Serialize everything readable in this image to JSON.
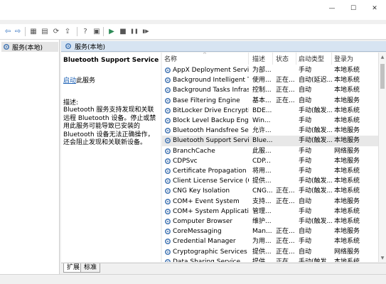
{
  "window": {
    "minimize_glyph": "—",
    "maximize_glyph": "☐",
    "close_glyph": "✕"
  },
  "toolbar": {
    "buttons": [
      {
        "name": "back-icon",
        "glyph": "⇦"
      },
      {
        "name": "forward-icon",
        "glyph": "⇨"
      },
      {
        "name": "console-tree-icon",
        "glyph": "▦"
      },
      {
        "name": "properties-icon",
        "glyph": "▤"
      },
      {
        "name": "refresh-icon",
        "glyph": "⟳"
      },
      {
        "name": "export-list-icon",
        "glyph": "⇪"
      },
      {
        "name": "help-icon",
        "glyph": "?"
      },
      {
        "name": "show-hide-icon",
        "glyph": "▣"
      },
      {
        "name": "start-icon",
        "glyph": "▶"
      },
      {
        "name": "stop-icon",
        "glyph": "■"
      },
      {
        "name": "pause-icon",
        "glyph": "❚❚"
      },
      {
        "name": "restart-icon",
        "glyph": "▮▶"
      }
    ]
  },
  "tree": {
    "item_label": "服务(本地)",
    "item_icon": "services-icon"
  },
  "header": {
    "title": "服务(本地)"
  },
  "description": {
    "service_name": "Bluetooth Support Service",
    "action_link": "启动",
    "action_suffix": "此服务",
    "label": "描述:",
    "text": "Bluetooth 服务支持发现和关联远程 Bluetooth 设备。停止或禁用此服务可能导致已安装的 Bluetooth 设备无法正确操作，还会阻止发现和关联新设备。"
  },
  "columns": {
    "name": "名称",
    "desc": "描述",
    "status": "状态",
    "startup": "启动类型",
    "logon": "登录为"
  },
  "services": [
    {
      "name": "AppX Deployment Servic...",
      "desc": "为部...",
      "status": "",
      "startup": "手动",
      "logon": "本地系统"
    },
    {
      "name": "Background Intelligent T...",
      "desc": "使用...",
      "status": "正在...",
      "startup": "自动(延迟...",
      "logon": "本地系统"
    },
    {
      "name": "Background Tasks Infras...",
      "desc": "控制...",
      "status": "正在...",
      "startup": "自动",
      "logon": "本地系统"
    },
    {
      "name": "Base Filtering Engine",
      "desc": "基本...",
      "status": "正在...",
      "startup": "自动",
      "logon": "本地服务"
    },
    {
      "name": "BitLocker Drive Encryptio...",
      "desc": "BDE...",
      "status": "",
      "startup": "手动(触发...",
      "logon": "本地系统"
    },
    {
      "name": "Block Level Backup Engi...",
      "desc": "Win...",
      "status": "",
      "startup": "手动",
      "logon": "本地系统"
    },
    {
      "name": "Bluetooth Handsfree Ser...",
      "desc": "允许...",
      "status": "",
      "startup": "手动(触发...",
      "logon": "本地服务"
    },
    {
      "name": "Bluetooth Support Service",
      "desc": "Blue...",
      "status": "",
      "startup": "手动(触发...",
      "logon": "本地服务",
      "selected": true
    },
    {
      "name": "BranchCache",
      "desc": "此服...",
      "status": "",
      "startup": "手动",
      "logon": "网络服务"
    },
    {
      "name": "CDPSvc",
      "desc": "CDP...",
      "status": "",
      "startup": "手动",
      "logon": "本地服务"
    },
    {
      "name": "Certificate Propagation",
      "desc": "将用...",
      "status": "",
      "startup": "手动",
      "logon": "本地系统"
    },
    {
      "name": "Client License Service (Cli...",
      "desc": "提供...",
      "status": "",
      "startup": "手动(触发...",
      "logon": "本地系统"
    },
    {
      "name": "CNG Key Isolation",
      "desc": "CNG...",
      "status": "正在...",
      "startup": "手动(触发...",
      "logon": "本地系统"
    },
    {
      "name": "COM+ Event System",
      "desc": "支持...",
      "status": "正在...",
      "startup": "自动",
      "logon": "本地服务"
    },
    {
      "name": "COM+ System Application",
      "desc": "管理...",
      "status": "",
      "startup": "手动",
      "logon": "本地系统"
    },
    {
      "name": "Computer Browser",
      "desc": "维护...",
      "status": "",
      "startup": "手动(触发...",
      "logon": "本地系统"
    },
    {
      "name": "CoreMessaging",
      "desc": "Man...",
      "status": "正在...",
      "startup": "自动",
      "logon": "本地服务"
    },
    {
      "name": "Credential Manager",
      "desc": "为用...",
      "status": "正在...",
      "startup": "手动",
      "logon": "本地系统"
    },
    {
      "name": "Cryptographic Services",
      "desc": "提供...",
      "status": "正在...",
      "startup": "自动",
      "logon": "网络服务"
    },
    {
      "name": "Data Sharing Service",
      "desc": "提供...",
      "status": "正在...",
      "startup": "手动(触发...",
      "logon": "本地系统"
    }
  ],
  "tabs": [
    "扩展",
    "标准"
  ],
  "colors": {
    "header_bg": "#d7e4f2",
    "link": "#1a5fb4",
    "selected_row": "#e8e8e8",
    "gear_blue": "#4a7bb7"
  }
}
